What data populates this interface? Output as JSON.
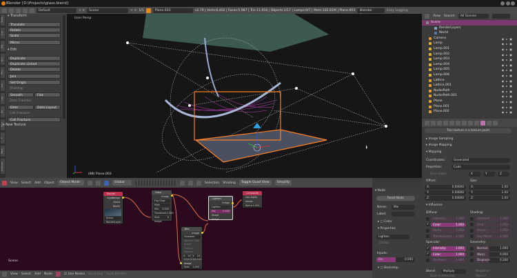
{
  "title_bar": {
    "title": "Blender [D:\\Projects\\glass.blend]"
  },
  "info_header": {
    "layout": "Default",
    "scene": "Scene",
    "frame": "1/1",
    "object": "Plane.003",
    "stats": "v2.79 | Verts:6,402 | Faces:5,987 | Tris:11,910 | Objects:1/17 | Lamps:0/7 | Mem:102.81M | Plane.003",
    "render_engine": "Blender Render",
    "easy_logging": "Easy Logging"
  },
  "toolshelf": {
    "tabs": [
      "Tools",
      "Cre",
      "Rel",
      "Ani",
      "Phy",
      "Grs",
      "Lay",
      "Ed",
      "Imp",
      "F",
      "Retk",
      "Custom"
    ],
    "transform_header": "Transform",
    "transform": [
      "Translate",
      "Rotate",
      "Scale"
    ],
    "mirror": "Mirror",
    "edit_header": "Edit",
    "edit": [
      "Duplicate",
      "Duplicate Linked",
      "Delete"
    ],
    "join": "Join",
    "set_origin": "Set Origin",
    "shading_label": "Shading:",
    "smooth": "Smooth",
    "flat": "Flat",
    "data_transfer_label": "Data Transfer:",
    "data": "Data",
    "data_layout": "Data Layout",
    "cell_fracture_label": "Cell Fracture",
    "cell_fracture": "Cell Fracture",
    "new_texture": "New Texture"
  },
  "viewport": {
    "label": "User Persp",
    "object_label": "(88) Plane.003"
  },
  "view3d_header": {
    "menus": [
      "View",
      "Select",
      "Add",
      "Object"
    ],
    "mode": "Object Mode",
    "orientation": "Global",
    "buttons": [
      "Selection",
      "Shading",
      "Toggle Quad View",
      "Simplify"
    ]
  },
  "node_editor": {
    "label": "Scene",
    "nodes": {
      "render_layers": {
        "title": "Render Layers",
        "outputs": [
          "Image",
          "Alpha",
          "Depth"
        ],
        "scene": "Scene",
        "layer": "RenderLayer"
      },
      "glare": {
        "title": "Glare",
        "output": "Image",
        "type": "Fog Glow",
        "quality": "High",
        "mix": "Mix:",
        "mix_val": "0.000",
        "threshold": "Threshold:",
        "threshold_val": "1.000",
        "size": "Size:",
        "size_val": "8",
        "input": "Image"
      },
      "lighten": {
        "title": "Lighten",
        "output": "Image",
        "mode": "Lighten",
        "clamp": "Clamp",
        "fac": "Fac",
        "fac_val": "0.500",
        "inputs": [
          "Image",
          "Image"
        ]
      },
      "composite": {
        "title": "Composite",
        "use_alpha": "Use Alpha",
        "input": "Image",
        "alpha": "Alpha:",
        "alpha_val": "1.000",
        "z": "Z:",
        "z_val": "1.000"
      },
      "blur": {
        "title": "Blur",
        "output": "Image",
        "filter": "Gaussian",
        "options": [
          "Variable Size",
          "Bokeh",
          "Gamma",
          "Relative"
        ],
        "x": "X:",
        "x_val": "16",
        "y": "Y:",
        "y_val": "16",
        "extend": "Extend Bounds",
        "input": "Image",
        "size": "Size:",
        "size_val": "1.000"
      }
    }
  },
  "node_header": {
    "menus": [
      "View",
      "Select",
      "Add",
      "Node"
    ],
    "use_nodes": "Use Nodes",
    "backdrop": "Backdrop",
    "auto_render": "Auto Render"
  },
  "node_sidebar": {
    "node_header": "Node",
    "reset_node": "Reset Node",
    "name_label": "Name:",
    "name": "Mix",
    "label_label": "Label:",
    "label": "",
    "color": "Color",
    "properties": "Properties",
    "blend": "Lighten",
    "clamp": "Clamp",
    "inputs": "Inputs:",
    "fac": "Fac",
    "fac_val": "0.500",
    "backdrop": "Backdrop"
  },
  "outliner": {
    "menus": [
      "View",
      "Search"
    ],
    "filter": "All Scenes",
    "items": [
      {
        "name": "Scene",
        "color": "#8a8a8a"
      },
      {
        "name": "RenderLayers",
        "color": "#8aa0c0"
      },
      {
        "name": "World",
        "color": "#5a7ab0"
      },
      {
        "name": "Camera",
        "color": "#e89a30"
      },
      {
        "name": "Lamp",
        "color": "#e8b030"
      },
      {
        "name": "Lamp.001",
        "color": "#e8b030"
      },
      {
        "name": "Lamp.002",
        "color": "#e8b030"
      },
      {
        "name": "Lamp.003",
        "color": "#e8b030"
      },
      {
        "name": "Lamp.004",
        "color": "#e8b030"
      },
      {
        "name": "Lamp.005",
        "color": "#e8b030"
      },
      {
        "name": "Lamp.006",
        "color": "#e8b030"
      },
      {
        "name": "Lattice",
        "color": "#e8a030"
      },
      {
        "name": "Lattice.001",
        "color": "#e8a030"
      },
      {
        "name": "NurbsPath",
        "color": "#e8a030"
      },
      {
        "name": "NurbsPath.001",
        "color": "#e8a030"
      },
      {
        "name": "Plane",
        "color": "#e8a030"
      },
      {
        "name": "Plane.001",
        "color": "#e8a030"
      },
      {
        "name": "Plane.002",
        "color": "#e8a030"
      }
    ]
  },
  "properties": {
    "texture_paint_notice": "This texture is a texture paint",
    "image_sampling": "Image Sampling",
    "image_mapping": "Image Mapping",
    "mapping": "Mapping",
    "coordinates_label": "Coordinates:",
    "coordinates": "Generated",
    "projection_label": "Projection:",
    "projection": "Cube",
    "from_dupli": "From Dupli",
    "axes": [
      "X",
      "Y",
      "Z"
    ],
    "offset_label": "Offset:",
    "offset": [
      {
        "axis": "X:",
        "value": "0.00000"
      },
      {
        "axis": "Y:",
        "value": "0.00000"
      },
      {
        "axis": "Z:",
        "value": "0.00000"
      }
    ],
    "size_label": "Size:",
    "size": [
      {
        "axis": "X:",
        "value": "1.00"
      },
      {
        "axis": "Y:",
        "value": "1.00"
      },
      {
        "axis": "Z:",
        "value": "1.00"
      }
    ],
    "influence": "Influence",
    "diffuse_label": "Diffuse:",
    "diffuse": [
      {
        "name": "Intensity:",
        "value": "1.000",
        "on": false
      },
      {
        "name": "Color:",
        "value": "1.000",
        "on": true
      },
      {
        "name": "Alpha:",
        "value": "1.000",
        "on": false
      },
      {
        "name": "Translucency:",
        "value": "1.000",
        "on": false
      }
    ],
    "shading_label": "Shading:",
    "shading": [
      {
        "name": "Ambient:",
        "value": "1.000"
      },
      {
        "name": "Emit:",
        "value": "1.000"
      },
      {
        "name": "Mirror:",
        "value": "1.000"
      },
      {
        "name": "Ray Mirror:",
        "value": "1.000"
      }
    ],
    "specular_label": "Specular:",
    "specular": [
      {
        "name": "Intensity:",
        "value": "1.000",
        "on": true
      },
      {
        "name": "Color:",
        "value": "1.000",
        "on": true
      },
      {
        "name": "Hardness:",
        "value": "1.000",
        "on": false
      }
    ],
    "geometry_label": "Geometry:",
    "geometry": [
      {
        "name": "Normal:",
        "value": "1.000"
      },
      {
        "name": "Warp:",
        "value": "0.000"
      },
      {
        "name": "Displace:",
        "value": "0.200"
      }
    ],
    "blend_label": "Blend:",
    "blend": "Multiply",
    "negative": "Negative",
    "rgb_to_intensity": "RGB to Intensity",
    "stencil": "Stencil"
  }
}
